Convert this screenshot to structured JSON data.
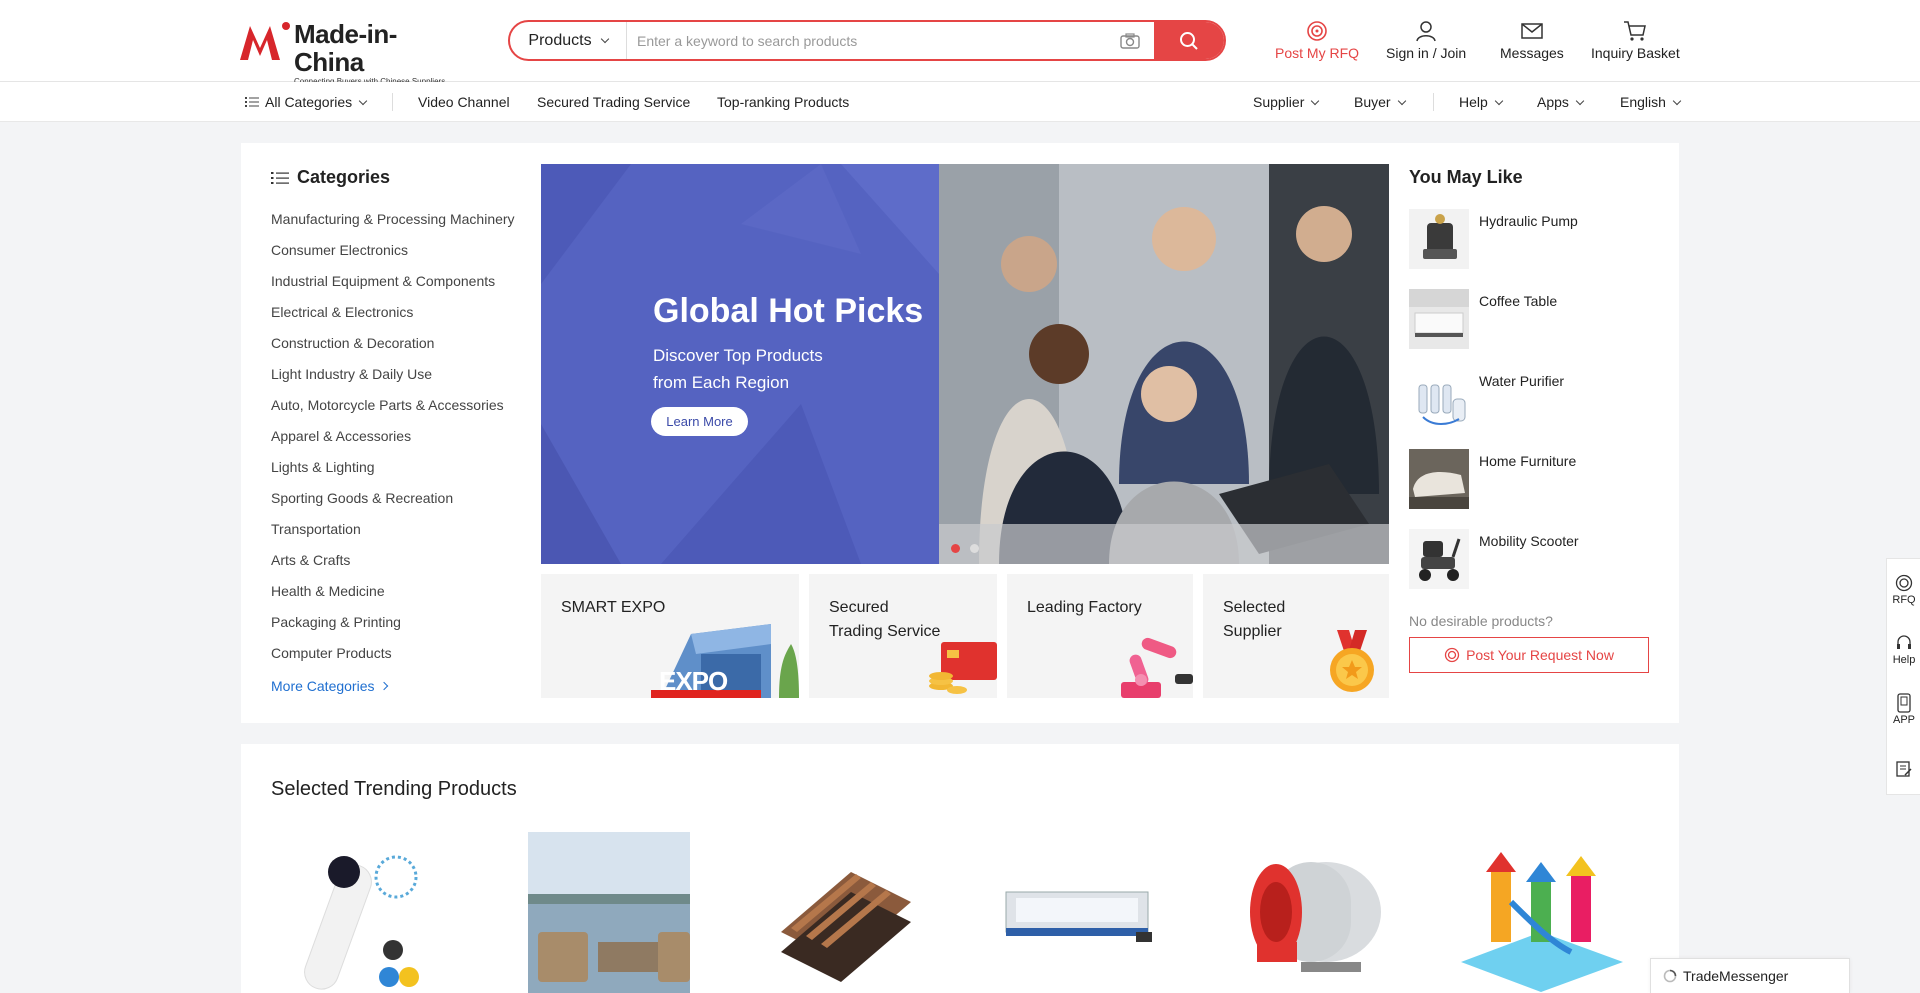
{
  "brand": {
    "name": "Made-in-China",
    "tagline": "Connecting Buyers with Chinese Suppliers",
    "accent_color": "#e54545"
  },
  "search": {
    "category": "Products",
    "placeholder": "Enter a keyword to search products"
  },
  "header_nav": {
    "rfq": "Post My RFQ",
    "signin": "Sign in / Join",
    "messages": "Messages",
    "basket": "Inquiry Basket"
  },
  "subnav": {
    "all_categories": "All Categories",
    "video": "Video Channel",
    "secured": "Secured Trading Service",
    "top_ranking": "Top-ranking Products",
    "supplier": "Supplier",
    "buyer": "Buyer",
    "help": "Help",
    "apps": "Apps",
    "language": "English"
  },
  "categories": {
    "title": "Categories",
    "items": [
      "Manufacturing & Processing Machinery",
      "Consumer Electronics",
      "Industrial Equipment & Components",
      "Electrical & Electronics",
      "Construction & Decoration",
      "Light Industry & Daily Use",
      "Auto, Motorcycle Parts & Accessories",
      "Apparel & Accessories",
      "Lights & Lighting",
      "Sporting Goods & Recreation",
      "Transportation",
      "Arts & Crafts",
      "Health & Medicine",
      "Packaging & Printing",
      "Computer Products"
    ],
    "more": "More Categories"
  },
  "banner": {
    "title": "Global Hot Picks",
    "subtitle_line1": "Discover Top Products",
    "subtitle_line2": "from Each Region",
    "button": "Learn More",
    "bg_color": "#5563c1"
  },
  "tiles": {
    "expo": "SMART EXPO",
    "expo_badge": "EXPO",
    "secured_line1": "Secured",
    "secured_line2": "Trading Service",
    "factory": "Leading Factory",
    "selected_line1": "Selected",
    "selected_line2": "Supplier"
  },
  "you_may_like": {
    "title": "You May Like",
    "items": [
      "Hydraulic Pump",
      "Coffee Table",
      "Water Purifier",
      "Home Furniture",
      "Mobility Scooter"
    ],
    "no_desire": "No desirable products?",
    "post_request": "Post Your Request Now"
  },
  "trending": {
    "title": "Selected Trending Products"
  },
  "sidebar": {
    "rfq": "RFQ",
    "help": "Help",
    "app": "APP"
  },
  "trade_messenger": "TradeMessenger"
}
